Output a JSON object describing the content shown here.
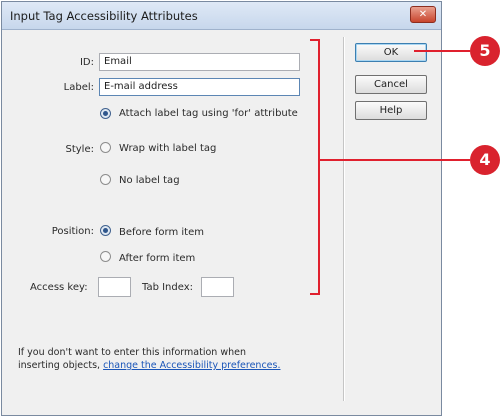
{
  "dialog": {
    "title": "Input Tag Accessibility Attributes",
    "close_glyph": "✕"
  },
  "fields": {
    "id_label": "ID:",
    "id_value": "Email",
    "label_label": "Label:",
    "label_value": "E-mail address",
    "access_key_label": "Access key:",
    "access_key_value": "",
    "tab_index_label": "Tab Index:",
    "tab_index_value": ""
  },
  "style": {
    "label": "Style:",
    "options": [
      {
        "label": "Attach label tag using 'for' attribute",
        "selected": true
      },
      {
        "label": "Wrap with label tag",
        "selected": false
      },
      {
        "label": "No label tag",
        "selected": false
      }
    ]
  },
  "position": {
    "label": "Position:",
    "options": [
      {
        "label": "Before form item",
        "selected": true
      },
      {
        "label": "After form item",
        "selected": false
      }
    ]
  },
  "buttons": {
    "ok": "OK",
    "cancel": "Cancel",
    "help": "Help"
  },
  "note": {
    "line1": "If you don't want to enter this information when",
    "line2_prefix": "inserting objects, ",
    "link": "change the Accessibility preferences."
  },
  "callouts": {
    "c5": "5",
    "c4": "4",
    "color": "#d9232e"
  }
}
